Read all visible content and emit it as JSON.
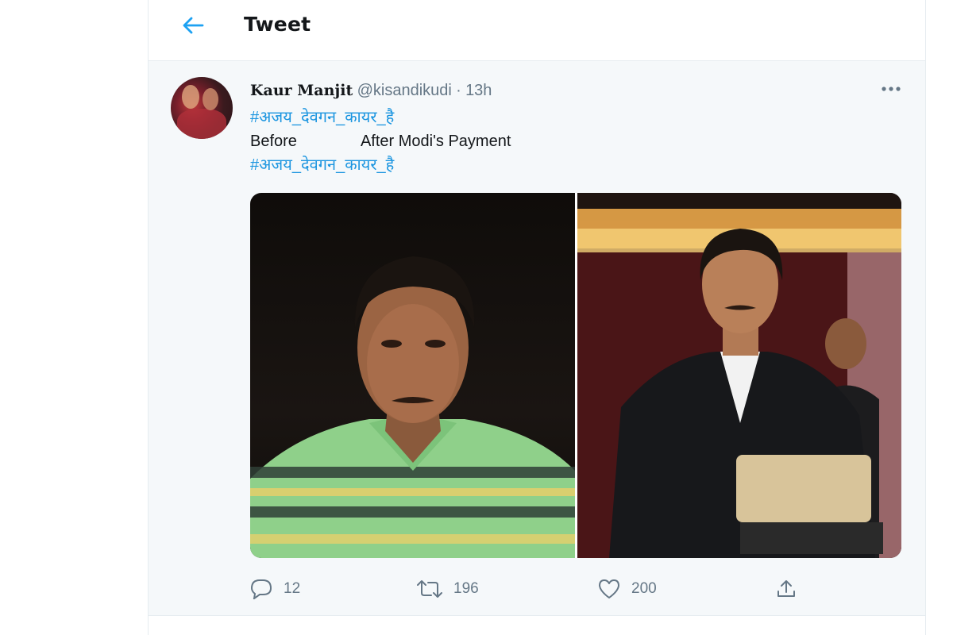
{
  "header": {
    "title": "Tweet"
  },
  "tweet": {
    "author_name": "Kaur Manjit",
    "author_handle": "@kisandikudi",
    "separator": "·",
    "time": "13h",
    "hashtag": "#अजय_देवगन_कायर_है",
    "line_before": "Before",
    "line_after": "After Modi's Payment",
    "media": {
      "left_caption": "",
      "right_caption": ""
    },
    "actions": {
      "reply_count": "12",
      "retweet_count": "196",
      "like_count": "200"
    }
  },
  "icons": {
    "back": "arrow-left-icon",
    "more": "more-horizontal-icon",
    "reply": "reply-icon",
    "retweet": "retweet-icon",
    "like": "heart-icon",
    "share": "share-icon"
  },
  "colors": {
    "accent": "#1da1f2",
    "hashtag": "#1b95e0",
    "muted": "#657786",
    "tweet_bg": "#f5f8fa"
  }
}
